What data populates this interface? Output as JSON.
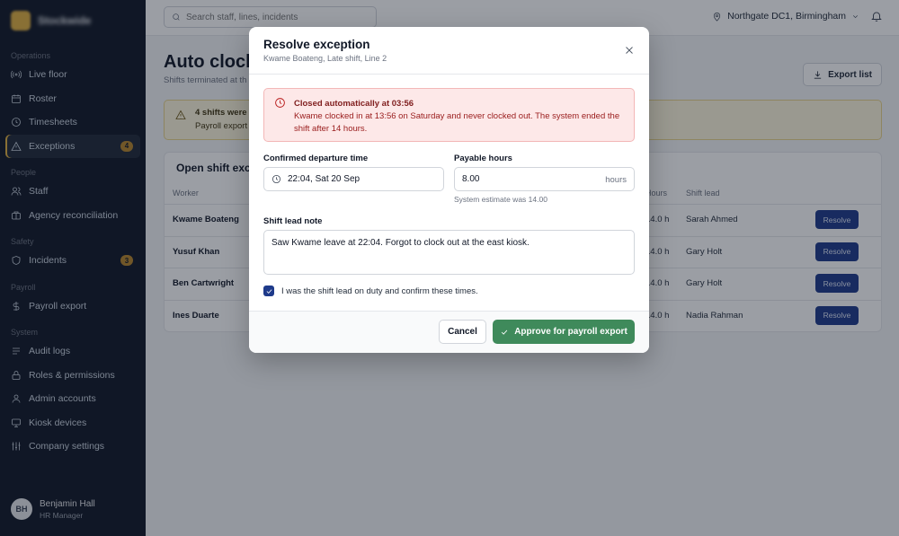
{
  "brand": {
    "name": "Stockwide"
  },
  "sidebar": {
    "groups": [
      {
        "label": "Operations",
        "items": [
          {
            "label": "Live floor",
            "icon": "signal-icon"
          },
          {
            "label": "Roster",
            "icon": "calendar-icon"
          },
          {
            "label": "Timesheets",
            "icon": "clock-icon"
          },
          {
            "label": "Exceptions",
            "icon": "warning-icon",
            "badge": "4",
            "active": true
          }
        ]
      },
      {
        "label": "People",
        "items": [
          {
            "label": "Staff",
            "icon": "users-icon"
          },
          {
            "label": "Agency reconciliation",
            "icon": "briefcase-icon"
          }
        ]
      },
      {
        "label": "Safety",
        "items": [
          {
            "label": "Incidents",
            "icon": "shield-icon",
            "badge": "3"
          }
        ]
      },
      {
        "label": "Payroll",
        "items": [
          {
            "label": "Payroll export",
            "icon": "dollar-icon"
          }
        ]
      },
      {
        "label": "System",
        "items": [
          {
            "label": "Audit logs",
            "icon": "list-icon"
          },
          {
            "label": "Roles & permissions",
            "icon": "lock-icon"
          },
          {
            "label": "Admin accounts",
            "icon": "user-icon"
          },
          {
            "label": "Kiosk devices",
            "icon": "monitor-icon"
          },
          {
            "label": "Company settings",
            "icon": "sliders-icon"
          }
        ]
      }
    ],
    "user": {
      "initials": "BH",
      "name": "Benjamin Hall",
      "role": "HR Manager"
    }
  },
  "topbar": {
    "search_placeholder": "Search staff, lines, incidents",
    "location": "Northgate DC1, Birmingham"
  },
  "page": {
    "title": "Auto clock",
    "subtitle": "Shifts terminated at th",
    "export_label": "Export list",
    "banner": {
      "title": "4 shifts were c",
      "text": "Payroll export"
    },
    "table": {
      "title": "Open shift exce",
      "columns": {
        "worker": "Worker",
        "hours": "Hours",
        "lead": "Shift lead"
      },
      "rows": [
        {
          "worker": "Kwame Boateng",
          "hours": "14.0 h",
          "lead": "Sarah Ahmed",
          "action": "Resolve"
        },
        {
          "worker": "Yusuf Khan",
          "hours": "14.0 h",
          "lead": "Gary Holt",
          "action": "Resolve"
        },
        {
          "worker": "Ben Cartwright",
          "hours": "14.0 h",
          "lead": "Gary Holt",
          "action": "Resolve"
        },
        {
          "worker": "Ines Duarte",
          "hours": "14.0 h",
          "lead": "Nadia Rahman",
          "action": "Resolve"
        }
      ]
    }
  },
  "modal": {
    "title": "Resolve exception",
    "subtitle": "Kwame Boateng, Late shift, Line 2",
    "alert": {
      "title": "Closed automatically at 03:56",
      "text": "Kwame clocked in at 13:56 on Saturday and never clocked out. The system ended the shift after 14 hours."
    },
    "departure": {
      "label": "Confirmed departure time",
      "value": "22:04, Sat 20 Sep"
    },
    "payable": {
      "label": "Payable hours",
      "value": "8.00",
      "suffix": "hours",
      "hint": "System estimate was 14.00"
    },
    "note": {
      "label": "Shift lead note",
      "value": "Saw Kwame leave at 22:04. Forgot to clock out at the east kiosk."
    },
    "confirm": {
      "label": "I was the shift lead on duty and confirm these times.",
      "checked": true
    },
    "cancel_label": "Cancel",
    "approve_label": "Approve for payroll export"
  },
  "colors": {
    "accent": "#1e3a8a",
    "success": "#3f8a5b",
    "danger": "#b91c1c",
    "warning": "#e0b040"
  }
}
